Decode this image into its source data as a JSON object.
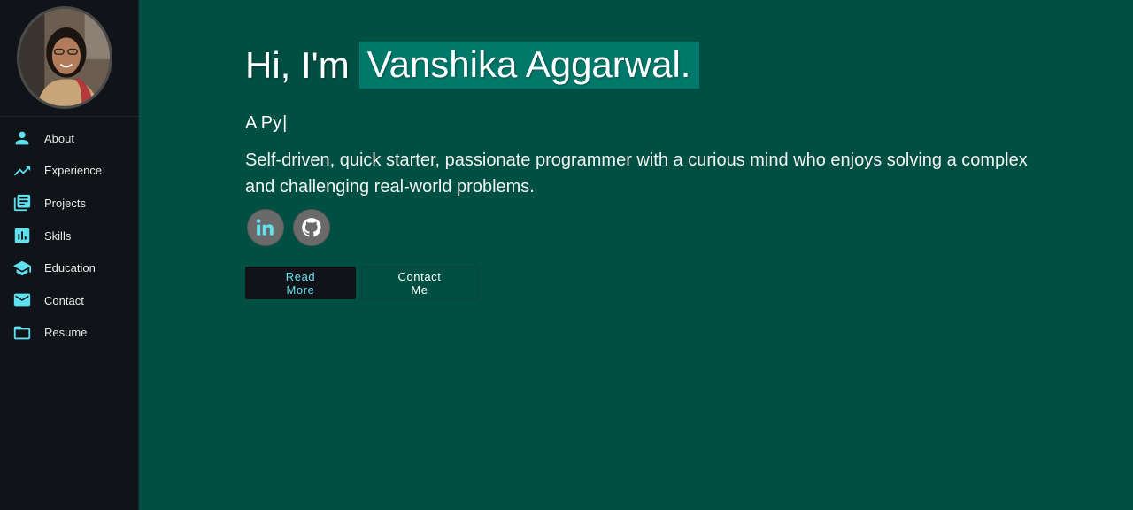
{
  "sidebar": {
    "avatar_alt": "",
    "items": [
      {
        "label": "About",
        "icon": "person-icon"
      },
      {
        "label": "Experience",
        "icon": "trending-up-icon"
      },
      {
        "label": "Projects",
        "icon": "library-books-icon"
      },
      {
        "label": "Skills",
        "icon": "bar-chart-icon"
      },
      {
        "label": "Education",
        "icon": "school-icon"
      },
      {
        "label": "Contact",
        "icon": "mail-icon"
      },
      {
        "label": "Resume",
        "icon": "folder-icon"
      }
    ]
  },
  "hero": {
    "greeting": "Hi, I'm",
    "name": "Vanshika Aggarwal.",
    "typed_text": "A Py",
    "cursor": "|",
    "bio": "Self-driven, quick starter, passionate programmer with a curious mind who enjoys solving a complex and challenging real-world problems."
  },
  "socials": [
    {
      "icon": "linkedin-icon"
    },
    {
      "icon": "github-icon"
    }
  ],
  "buttons": {
    "read_more": "Read More",
    "contact_me": "Contact Me"
  },
  "colors": {
    "background": "#004f43",
    "sidebar": "#101317",
    "accent": "#5fe1f0",
    "name_highlight": "#00796b",
    "social_bg": "#6a6a6a"
  }
}
